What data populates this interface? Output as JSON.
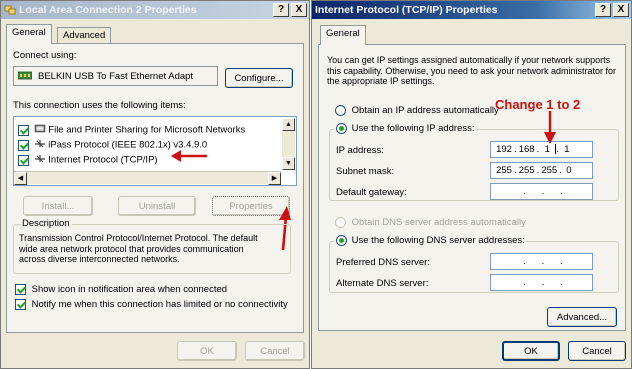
{
  "left_window": {
    "title": "Local Area Connection 2 Properties",
    "help_button": "?",
    "close_button": "X",
    "tabs": [
      "General",
      "Advanced"
    ],
    "connect_using_label": "Connect using:",
    "adapter_name": "BELKIN USB To Fast Ethernet Adapt",
    "configure_button": "Configure...",
    "items_label": "This connection uses the following items:",
    "items": [
      {
        "label": "File and Printer Sharing for Microsoft Networks"
      },
      {
        "label": "iPass Protocol (IEEE 802.1x) v3.4.9.0"
      },
      {
        "label": "Internet Protocol (TCP/IP)"
      }
    ],
    "install_button": "Install...",
    "uninstall_button": "Uninstall",
    "properties_button": "Properties",
    "description_label": "Description",
    "description_text": "Transmission Control Protocol/Internet Protocol. The default wide area network protocol that provides communication across diverse interconnected networks.",
    "show_icon_label": "Show icon in notification area when connected",
    "notify_label": "Notify me when this connection has limited or no connectivity",
    "ok_button": "OK",
    "cancel_button": "Cancel"
  },
  "right_window": {
    "title": "Internet Protocol (TCP/IP) Properties",
    "help_button": "?",
    "close_button": "X",
    "tab": "General",
    "intro_text": "You can get IP settings assigned automatically if your network supports this capability. Otherwise, you need to ask your network administrator for the appropriate IP settings.",
    "obtain_ip_auto": "Obtain an IP address automatically",
    "use_following_ip": "Use the following IP address:",
    "ip_label": "IP address:",
    "ip": [
      "192",
      "168",
      "1",
      "1"
    ],
    "subnet_label": "Subnet mask:",
    "subnet": [
      "255",
      "255",
      "255",
      "0"
    ],
    "gateway_label": "Default gateway:",
    "obtain_dns_auto": "Obtain DNS server address automatically",
    "use_following_dns": "Use the following DNS server addresses:",
    "preferred_dns_label": "Preferred DNS server:",
    "alternate_dns_label": "Alternate DNS server:",
    "advanced_button": "Advanced...",
    "ok_button": "OK",
    "cancel_button": "Cancel"
  },
  "annotation": {
    "text": "Change 1 to 2",
    "color": "#cc1111"
  },
  "colors": {
    "titlebar_start": "#0a246a",
    "titlebar_end": "#a6caf0",
    "arrow": "#cc1111"
  }
}
